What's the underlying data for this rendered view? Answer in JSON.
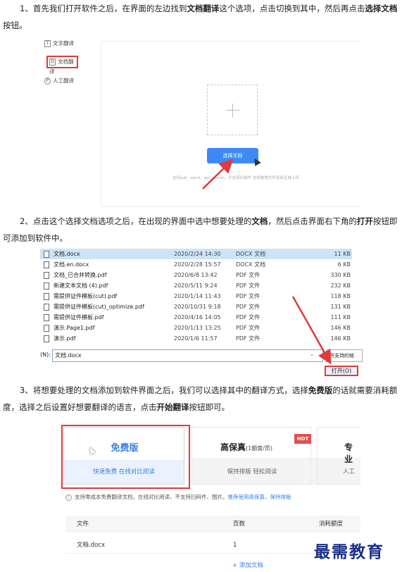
{
  "step1": {
    "parts": [
      {
        "text": "1、首先我们打开软件之后，在界面的左边找到",
        "bold": false
      },
      {
        "text": "文档翻译",
        "bold": true
      },
      {
        "text": "这个选项，点击切换到其中，然后再点击",
        "bold": false
      },
      {
        "text": "选择文档",
        "bold": true
      },
      {
        "text": "按钮。",
        "bold": false
      }
    ]
  },
  "shot1": {
    "sidebar": [
      {
        "icon": "T",
        "label": "文字翻译"
      },
      {
        "icon": "D",
        "label": "文档翻译"
      },
      {
        "icon": "P",
        "label": "人工翻译"
      }
    ],
    "select_button": "选择文档",
    "hint": "支持pdf、word、ppt、excel，不支持扫描件 支持拖拽文件到此区域上传"
  },
  "step2": {
    "parts": [
      {
        "text": "2、点击这个选择文档选项之后，在出现的界面中选中想要处理的",
        "bold": false
      },
      {
        "text": "文档",
        "bold": true
      },
      {
        "text": "，然后点击界面右下角的",
        "bold": false
      },
      {
        "text": "打开",
        "bold": true
      },
      {
        "text": "按钮即可添加到软件中。",
        "bold": false
      }
    ]
  },
  "shot2": {
    "files": [
      {
        "name": "文档.docx",
        "date": "2020/2/24 14:30",
        "type": "DOCX 文档",
        "size": "11 KB",
        "selected": true
      },
      {
        "name": "文档.en.docx",
        "date": "2020/2/28 15:57",
        "type": "DOCX 文档",
        "size": "6 KB",
        "selected": false
      },
      {
        "name": "文档_已合并转换.pdf",
        "date": "2020/6/8 13:42",
        "type": "PDF 文件",
        "size": "330 KB",
        "selected": false
      },
      {
        "name": "新建文本文档 (4).pdf",
        "date": "2020/5/11 9:24",
        "type": "PDF 文件",
        "size": "232 KB",
        "selected": false
      },
      {
        "name": "需提供证件模板(cut).pdf",
        "date": "2020/1/14 11:43",
        "type": "PDF 文件",
        "size": "118 KB",
        "selected": false
      },
      {
        "name": "需提供证件模板(cut)_optimize.pdf",
        "date": "2020/10/31 9:18",
        "type": "PDF 文件",
        "size": "131 KB",
        "selected": false
      },
      {
        "name": "需提供证件模板.pdf",
        "date": "2020/4/16 14:05",
        "type": "PDF 文件",
        "size": "111 KB",
        "selected": false
      },
      {
        "name": "演示.Page1.pdf",
        "date": "2020/1/13 13:25",
        "type": "PDF 文件",
        "size": "146 KB",
        "selected": false
      },
      {
        "name": "演示.pdf",
        "date": "2020/1/6 11:57",
        "type": "PDF 文件",
        "size": "146 KB",
        "selected": false
      }
    ],
    "filename_label": "(N):",
    "filename_value": "文档.docx",
    "filter_label": "所支持的格",
    "open_button": "打开(O)"
  },
  "step3": {
    "parts": [
      {
        "text": "3、将想要处理的文档添加到软件界面之后，我们可以选择其中的翻译方式，选择",
        "bold": false
      },
      {
        "text": "免费版",
        "bold": true
      },
      {
        "text": "的话就需要消耗额度，选择之后设置好想要翻译的语言，点击",
        "bold": false
      },
      {
        "text": "开始翻译",
        "bold": true
      },
      {
        "text": "按钮即可。",
        "bold": false
      }
    ]
  },
  "shot3": {
    "free": {
      "name": "免费版",
      "desc": "快速免费 在线对比阅读"
    },
    "pro": {
      "name": "高保真",
      "sub": "(1额度/页)",
      "desc": "保持排版 轻松阅读",
      "badge": "HOT"
    },
    "human": {
      "name": "专业",
      "desc": "人工"
    },
    "notice": "支持零成本免费翻译文档，在线对比阅读，不支持扫码件、图片。",
    "notice_link": "推荐使用高保真，保持排版",
    "table_headers": [
      "文件",
      "页数",
      "消耗额度"
    ],
    "table_rows": [
      {
        "file": "文档.docx",
        "pages": "1",
        "cost": ""
      }
    ],
    "add_file": "+ 添加文档"
  },
  "watermark": "最需教育",
  "colors": {
    "accent": "#3a7ee8",
    "highlight": "#e03a3a",
    "selected_row": "#cce4f7"
  }
}
